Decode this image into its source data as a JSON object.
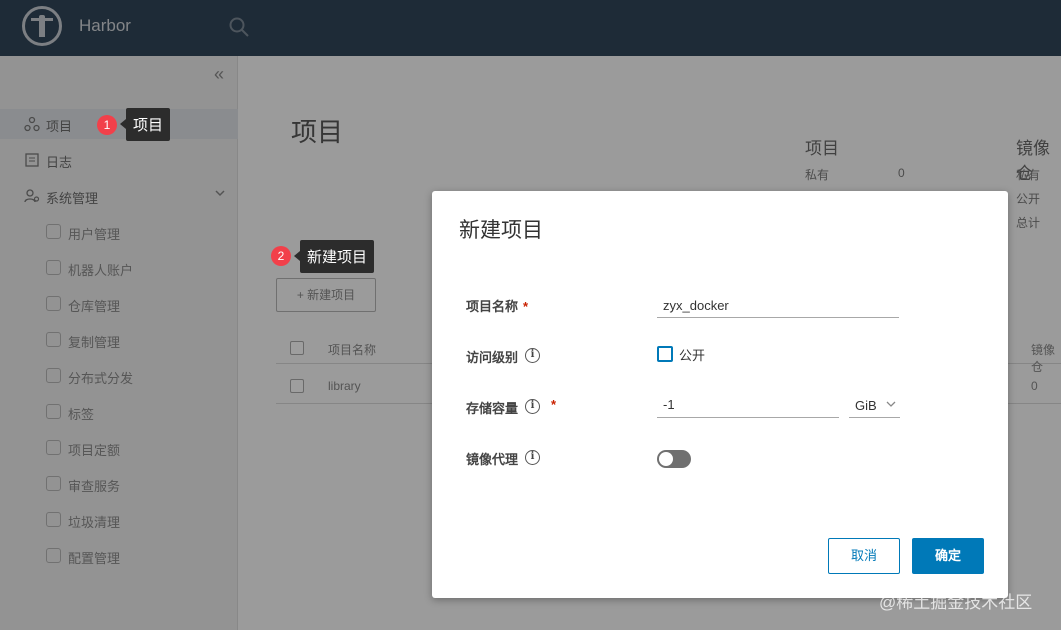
{
  "header": {
    "brand": "Harbor"
  },
  "sidebar": {
    "collapse_symbol": "«",
    "items": [
      {
        "label": "项目",
        "icon": "projects-icon",
        "active": true
      },
      {
        "label": "日志",
        "icon": "logs-icon"
      },
      {
        "label": "系统管理",
        "icon": "admin-icon",
        "expanded": true
      }
    ],
    "sub_items": [
      {
        "label": "用户管理",
        "icon": "users-icon"
      },
      {
        "label": "机器人账户",
        "icon": "robot-icon"
      },
      {
        "label": "仓库管理",
        "icon": "registry-icon"
      },
      {
        "label": "复制管理",
        "icon": "replication-icon"
      },
      {
        "label": "分布式分发",
        "icon": "distribution-icon"
      },
      {
        "label": "标签",
        "icon": "tag-icon"
      },
      {
        "label": "项目定额",
        "icon": "quota-icon"
      },
      {
        "label": "审查服务",
        "icon": "shield-icon"
      },
      {
        "label": "垃圾清理",
        "icon": "trash-icon"
      },
      {
        "label": "配置管理",
        "icon": "gear-icon"
      }
    ]
  },
  "callouts": [
    {
      "number": "1",
      "text": "项目"
    },
    {
      "number": "2",
      "text": "新建项目"
    }
  ],
  "main": {
    "title": "项目",
    "summary": {
      "projects_header": "项目",
      "private_label": "私有",
      "private_value": "0",
      "repos_header": "镜像仓",
      "repo_rows": [
        "私有",
        "公开",
        "总计"
      ]
    },
    "new_project_button": "+ 新建项目",
    "table": {
      "columns": [
        "项目名称"
      ],
      "right_column": "镜像仓",
      "rows": [
        {
          "name": "library",
          "repo_count": "0"
        }
      ]
    }
  },
  "modal": {
    "title": "新建项目",
    "fields": {
      "name_label": "项目名称",
      "name_value": "zyx_docker",
      "access_label": "访问级别",
      "public_label": "公开",
      "storage_label": "存储容量",
      "storage_value": "-1",
      "storage_unit": "GiB",
      "proxy_label": "镜像代理"
    },
    "required_mark": "*",
    "info_symbol": "i",
    "cancel": "取消",
    "confirm": "确定"
  },
  "watermark": "@稀土掘金技术社区",
  "colors": {
    "header": "#314659",
    "primary": "#0079b8",
    "callout_dot": "#f2404a"
  }
}
